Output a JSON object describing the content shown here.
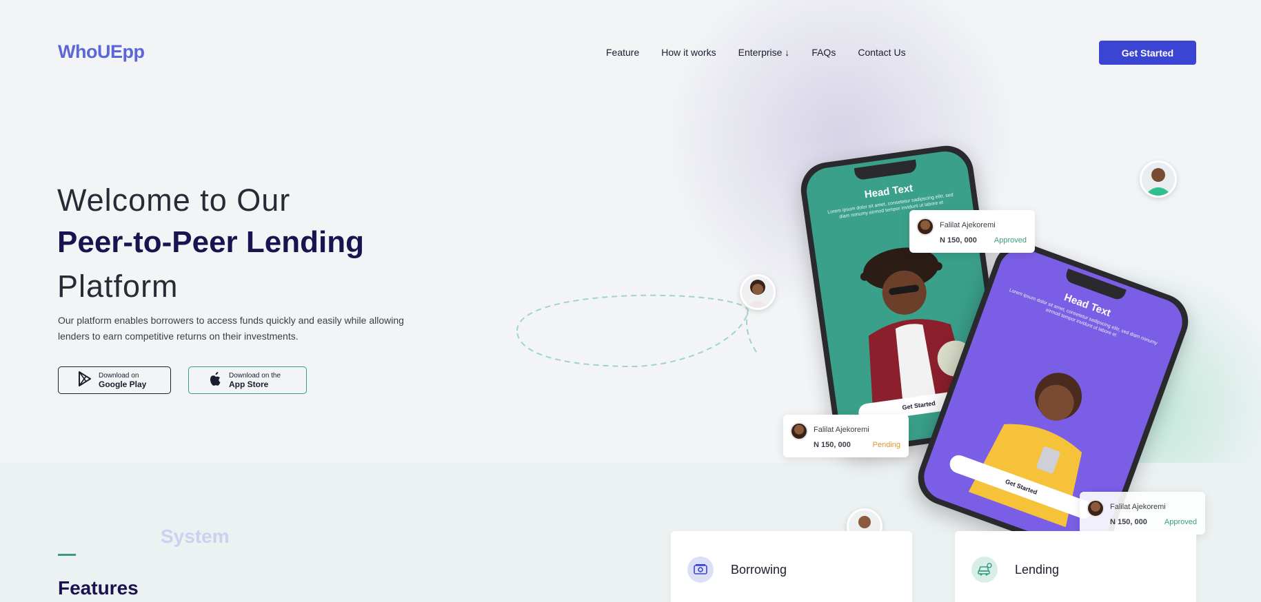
{
  "brand": {
    "logo": "WhoUEpp"
  },
  "nav": {
    "items": [
      "Feature",
      "How it works",
      "Enterprise ↓",
      "FAQs",
      "Contact Us"
    ],
    "cta": "Get Started"
  },
  "hero": {
    "line1": "Welcome to Our",
    "line2": "Peer-to-Peer Lending",
    "line3": "Platform",
    "description": "Our platform enables borrowers to access funds quickly and easily while allowing lenders to earn competitive returns on their investments.",
    "google_play": {
      "small": "Download on",
      "big": "Google Play"
    },
    "app_store": {
      "small": "Download on the",
      "big": "App Store"
    }
  },
  "phones": {
    "green": {
      "head": "Head Text",
      "sub": "Lorem ipsum dolor sit amet, consetetur sadipscing elitr, sed diam nonumy eirmod tempor invidunt ut labore et",
      "button": "Get Started",
      "color": "#3aa08a"
    },
    "purple": {
      "head": "Head Text",
      "sub": "Lorem ipsum dolor sit amet, consetetur sadipscing elitr, sed diam nonumy eirmod tempor invidunt ut labore et",
      "button": "Get Started",
      "color": "#7a5ee6"
    }
  },
  "status_cards": [
    {
      "name": "Falilat Ajekoremi",
      "amount": "N 150, 000",
      "status": "Approved",
      "status_color": "#3a9a84"
    },
    {
      "name": "Falilat Ajekoremi",
      "amount": "N 150, 000",
      "status": "Pending",
      "status_color": "#e0952e"
    },
    {
      "name": "Falilat Ajekoremi",
      "amount": "N 150, 000",
      "status": "Approved",
      "status_color": "#3a9a84"
    }
  ],
  "features": {
    "kicker": "System",
    "title": "Features",
    "cards": [
      {
        "title": "Borrowing",
        "icon": "money-icon"
      },
      {
        "title": "Lending",
        "icon": "car-loan-icon"
      }
    ]
  },
  "colors": {
    "accent": "#3a45d4",
    "brand": "#5b67d8",
    "heading": "#1a1350",
    "teal": "#3a9a84"
  }
}
